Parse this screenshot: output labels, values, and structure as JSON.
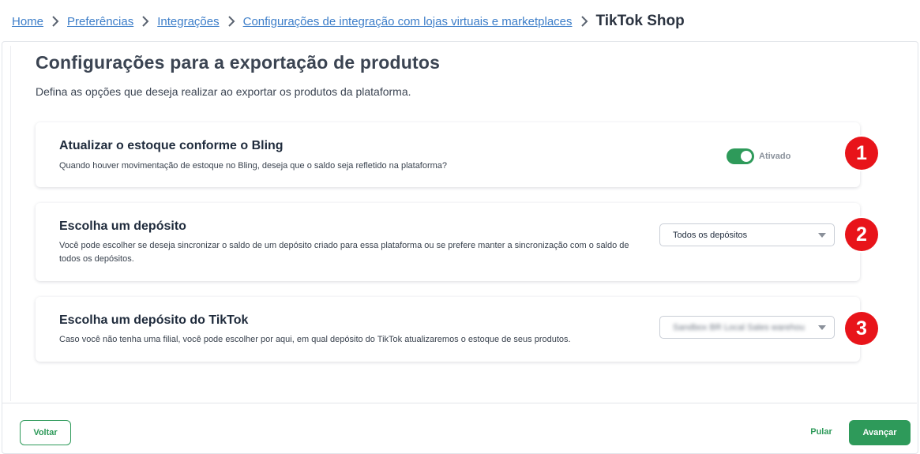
{
  "breadcrumb": {
    "items": [
      "Home",
      "Preferências",
      "Integrações",
      "Configurações de integração com lojas virtuais e marketplaces"
    ],
    "current": "TikTok Shop"
  },
  "page": {
    "title": "Configurações para a exportação de produtos",
    "subtitle": "Defina as opções que deseja realizar ao exportar os produtos da plataforma."
  },
  "cards": [
    {
      "title": "Atualizar o estoque conforme o Bling",
      "description": "Quando houver movimentação de estoque no Bling, deseja que o saldo seja refletido na plataforma?",
      "toggle": {
        "on": true,
        "label": "Ativado",
        "color": "#2e9a5a"
      },
      "marker": "1"
    },
    {
      "title": "Escolha um depósito",
      "description": "Você pode escolher se deseja sincronizar o saldo de um depósito criado para essa plataforma ou se prefere manter a sincronização com o saldo de todos os depósitos.",
      "select_value": "Todos os depósitos",
      "marker": "2"
    },
    {
      "title": "Escolha um depósito do TikTok",
      "description": "Caso você não tenha uma filial, você pode escolher por aqui, em qual depósito do TikTok atualizaremos o estoque de seus produtos.",
      "select_value": "Sandbox BR Local Sales warehou",
      "marker": "3"
    }
  ],
  "footer": {
    "back_label": "Voltar",
    "skip_label": "Pular",
    "next_label": "Avançar"
  },
  "colors": {
    "accent": "#2e9a5a",
    "link": "#3d7ec9",
    "marker": "#e8141a"
  }
}
